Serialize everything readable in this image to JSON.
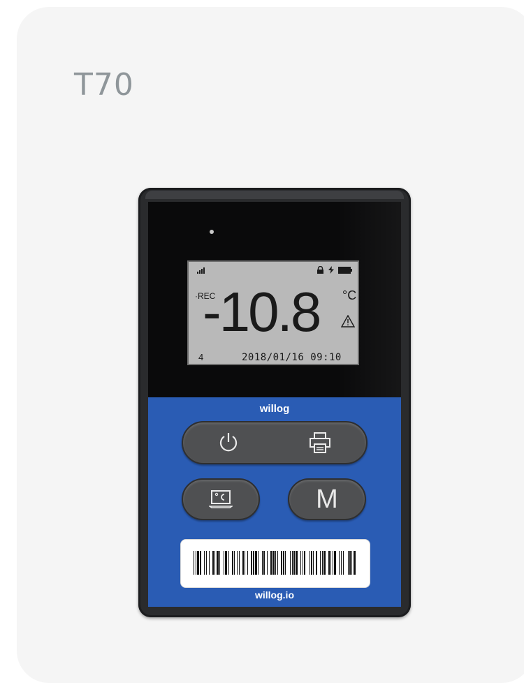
{
  "page": {
    "title": "T70"
  },
  "device": {
    "lcd": {
      "rec_label": "·REC",
      "temperature": "-10.8",
      "unit": "°C",
      "counter": "4",
      "datetime": "2018/01/16  09:10"
    },
    "brand": "willog",
    "website": "willog.io",
    "buttons": {
      "power": "power-icon",
      "print": "printer-icon",
      "pc": "pc-temperature-icon",
      "mode_label": "M"
    },
    "colors": {
      "panel": "#2a5cb4",
      "lcd": "#b9b9b9",
      "frame": "#2a2b2d"
    }
  }
}
